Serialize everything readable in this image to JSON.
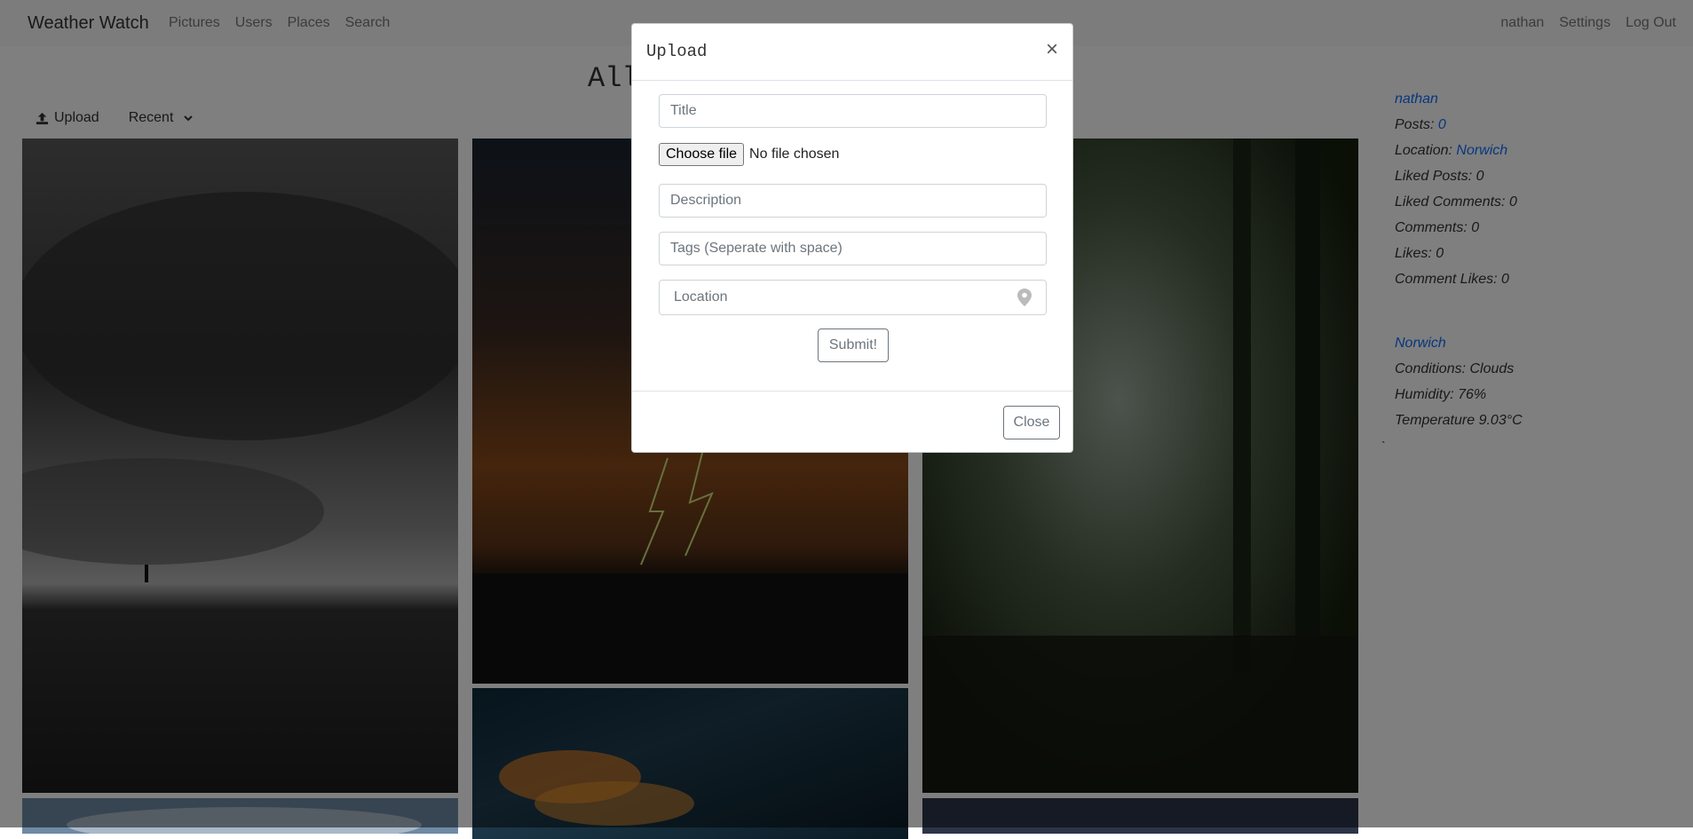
{
  "navbar": {
    "brand": "Weather Watch",
    "left_links": [
      "Pictures",
      "Users",
      "Places",
      "Search"
    ],
    "right_links": [
      "nathan",
      "Settings",
      "Log Out"
    ]
  },
  "page": {
    "title": "All",
    "upload_label": "Upload",
    "sort_label": "Recent"
  },
  "sidebar": {
    "username": "nathan",
    "posts_label": "Posts:",
    "posts_value": "0",
    "location_label": "Location:",
    "location_value": "Norwich",
    "liked_posts": "Liked Posts: 0",
    "liked_comments": "Liked Comments: 0",
    "comments": "Comments: 0",
    "likes": "Likes: 0",
    "comment_likes": "Comment Likes: 0",
    "place": "Norwich",
    "conditions": "Conditions: Clouds",
    "humidity": "Humidity: 76%",
    "temperature": "Temperature 9.03°C",
    "stray_mark": "`"
  },
  "modal": {
    "title": "Upload",
    "close_symbol": "×",
    "title_placeholder": "Title",
    "choose_file_label": "Choose file",
    "no_file_text": "No file chosen",
    "description_placeholder": "Description",
    "tags_placeholder": "Tags (Seperate with space)",
    "location_placeholder": "Location",
    "submit_label": "Submit!",
    "close_label": "Close"
  },
  "icons": {
    "upload": "upload-icon",
    "sort": "chevron-down-icon",
    "location": "map-marker-icon",
    "close": "close-icon"
  },
  "colors": {
    "link": "#0d6efd",
    "backdrop": "rgba(0,0,0,0.5)"
  }
}
